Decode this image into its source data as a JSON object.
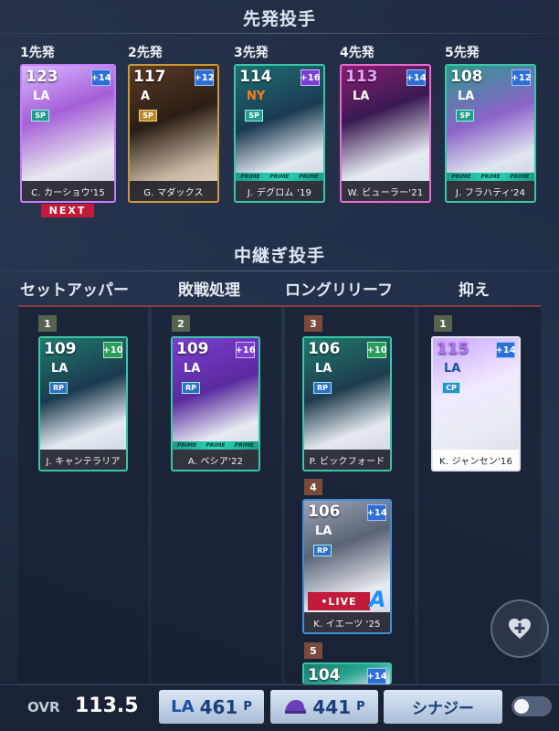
{
  "starters": {
    "title": "先発投手",
    "slots": [
      {
        "label": "1先発",
        "ovr": "123",
        "plus": "+14",
        "pos": "SP",
        "name": "C. カーショウ'15",
        "next": "NEXT"
      },
      {
        "label": "2先発",
        "ovr": "117",
        "plus": "+12",
        "pos": "SP",
        "name": "G. マダックス"
      },
      {
        "label": "3先発",
        "ovr": "114",
        "plus": "+16",
        "pos": "SP",
        "name": "J. デグロム '19"
      },
      {
        "label": "4先発",
        "ovr": "113",
        "plus": "+14",
        "pos": "",
        "name": "W. ビューラー'21"
      },
      {
        "label": "5先発",
        "ovr": "108",
        "plus": "+12",
        "pos": "SP",
        "name": "J. フラハティ'24"
      }
    ]
  },
  "relievers": {
    "title": "中継ぎ投手",
    "columns": [
      {
        "header": "セットアッパー"
      },
      {
        "header": "敗戦処理"
      },
      {
        "header": "ロングリリーフ"
      },
      {
        "header": "抑え"
      }
    ],
    "cards": [
      {
        "rank": "1",
        "ovr": "109",
        "plus": "+10",
        "pos": "RP",
        "name": "J. キャンテラリア"
      },
      {
        "rank": "2",
        "ovr": "109",
        "plus": "+16",
        "pos": "RP",
        "name": "A. ベシア'22"
      },
      {
        "rank": "3",
        "ovr": "106",
        "plus": "+10",
        "pos": "RP",
        "name": "P. ビックフォード"
      },
      {
        "rank": "1",
        "ovr": "115",
        "plus": "+14",
        "pos": "CP",
        "name": "K. ジャンセン'16"
      },
      {
        "rank": "4",
        "ovr": "106",
        "plus": "+14",
        "pos": "RP",
        "name": "K. イエーツ '25",
        "live": "•LIVE"
      },
      {
        "rank": "5",
        "ovr": "104",
        "plus": "+14",
        "pos": "",
        "name": ""
      }
    ]
  },
  "bottom": {
    "ovr_label": "OVR",
    "ovr_value": "113.5",
    "team_points": "461",
    "team_points_unit": "P",
    "other_points": "441",
    "other_points_unit": "P",
    "synergy_label": "シナジー"
  },
  "colors": {
    "next": "#c21a3a",
    "rule": "#8a3b3b",
    "plus_badge": "#2e6fd6"
  }
}
